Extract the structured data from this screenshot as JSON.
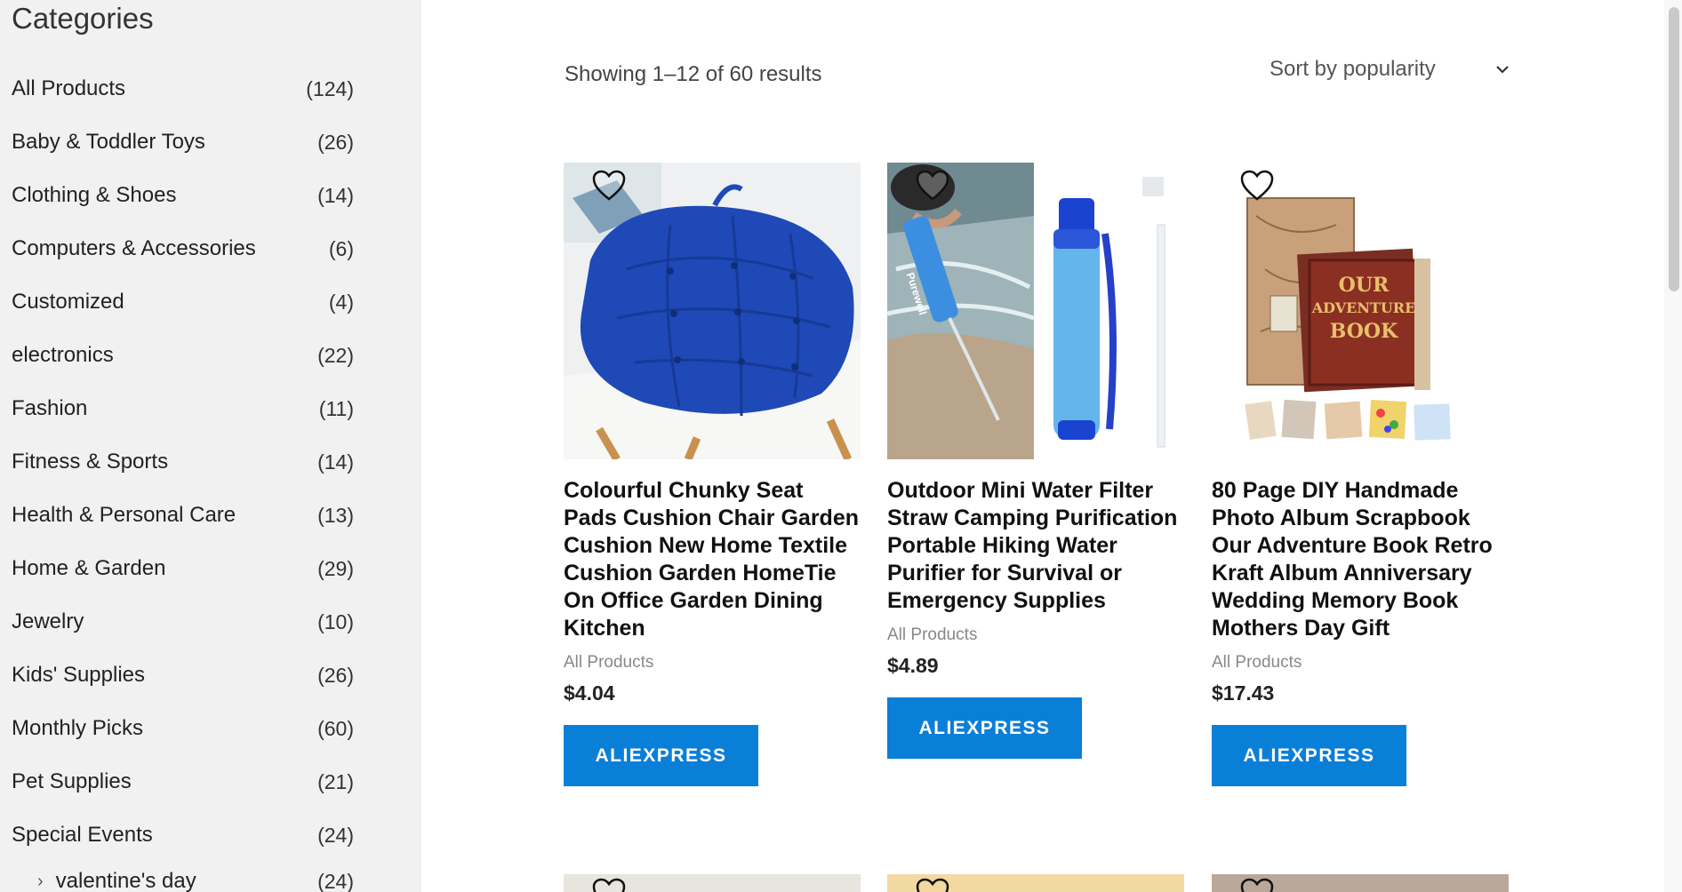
{
  "sidebar": {
    "title": "Categories",
    "items": [
      {
        "label": "All Products",
        "count": "(124)"
      },
      {
        "label": "Baby & Toddler Toys",
        "count": "(26)"
      },
      {
        "label": "Clothing & Shoes",
        "count": "(14)"
      },
      {
        "label": "Computers & Accessories",
        "count": "(6)"
      },
      {
        "label": "Customized",
        "count": "(4)"
      },
      {
        "label": "electronics",
        "count": "(22)"
      },
      {
        "label": "Fashion",
        "count": "(11)"
      },
      {
        "label": "Fitness & Sports",
        "count": "(14)"
      },
      {
        "label": "Health & Personal Care",
        "count": "(13)"
      },
      {
        "label": "Home & Garden",
        "count": "(29)"
      },
      {
        "label": "Jewelry",
        "count": "(10)"
      },
      {
        "label": "Kids' Supplies",
        "count": "(26)"
      },
      {
        "label": "Monthly Picks",
        "count": "(60)"
      },
      {
        "label": "Pet Supplies",
        "count": "(21)"
      },
      {
        "label": "Special Events",
        "count": "(24)"
      }
    ],
    "subitem": {
      "label": "valentine's day",
      "count": "(24)"
    }
  },
  "results_text": "Showing 1–12 of 60 results",
  "sort": {
    "label": "Sort by popularity"
  },
  "products": [
    {
      "title": "Colourful Chunky Seat Pads Cushion Chair Garden Cushion New Home Textile Cushion Garden HomeTie On Office Garden Dining Kitchen",
      "category": "All Products",
      "price": "$4.04",
      "button": "ALIEXPRESS"
    },
    {
      "title": "Outdoor Mini Water Filter Straw Camping Purification Portable Hiking Water Purifier for Survival or Emergency Supplies",
      "category": "All Products",
      "price": "$4.89",
      "button": "ALIEXPRESS",
      "brand_text": "Purewell"
    },
    {
      "title": "80 Page DIY Handmade Photo Album Scrapbook Our Adventure Book Retro Kraft Album Anniversary Wedding Memory Book Mothers Day Gift",
      "category": "All Products",
      "price": "$17.43",
      "button": "ALIEXPRESS",
      "cover_text": [
        "OUR",
        "ADVENTURE",
        "BOOK"
      ]
    }
  ],
  "colors": {
    "accent": "#0a7fd8",
    "sidebar_bg": "#f1f1f1"
  }
}
